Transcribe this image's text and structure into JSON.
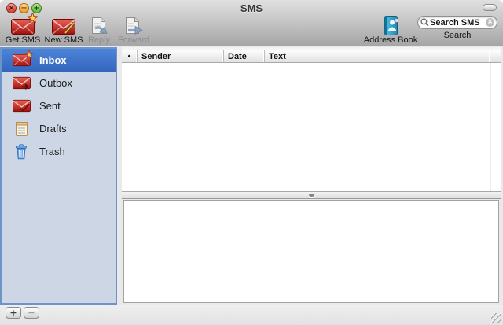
{
  "window": {
    "title": "SMS",
    "controls": {
      "close": "×",
      "minimize": "−",
      "zoom": "+"
    }
  },
  "toolbar": {
    "items": [
      {
        "label": "Get SMS",
        "icon": "envelope-star-icon",
        "enabled": true
      },
      {
        "label": "New SMS",
        "icon": "envelope-pencil-icon",
        "enabled": true
      },
      {
        "label": "Reply",
        "icon": "document-reply-arrow-icon",
        "enabled": false
      },
      {
        "label": "Forward",
        "icon": "document-forward-arrow-icon",
        "enabled": false
      },
      {
        "label": "Address Book",
        "icon": "address-book-icon",
        "enabled": true
      }
    ],
    "search": {
      "value": "Search SMS",
      "label": "Search",
      "icon": "magnifier-icon",
      "clear": "×"
    }
  },
  "sidebar": {
    "items": [
      {
        "label": "Inbox",
        "icon": "inbox-envelope-icon",
        "selected": true
      },
      {
        "label": "Outbox",
        "icon": "outbox-envelope-icon",
        "selected": false
      },
      {
        "label": "Sent",
        "icon": "sent-envelope-icon",
        "selected": false
      },
      {
        "label": "Drafts",
        "icon": "drafts-notepad-icon",
        "selected": false
      },
      {
        "label": "Trash",
        "icon": "trash-can-icon",
        "selected": false
      }
    ]
  },
  "message_list": {
    "columns": [
      "•",
      "Sender",
      "Date",
      "Text"
    ],
    "rows": []
  },
  "preview": {
    "content": ""
  },
  "footer": {
    "add": "+",
    "remove": "−"
  },
  "colors": {
    "selection-top": "#4d84d8",
    "selection-bottom": "#3465bd",
    "sidebar-bg": "#cdd6e4",
    "sidebar-border": "#6d94c8",
    "toolbar-top": "#e0e0e0",
    "toolbar-bottom": "#a6a6a6",
    "envelope-red": "#c1241c"
  }
}
